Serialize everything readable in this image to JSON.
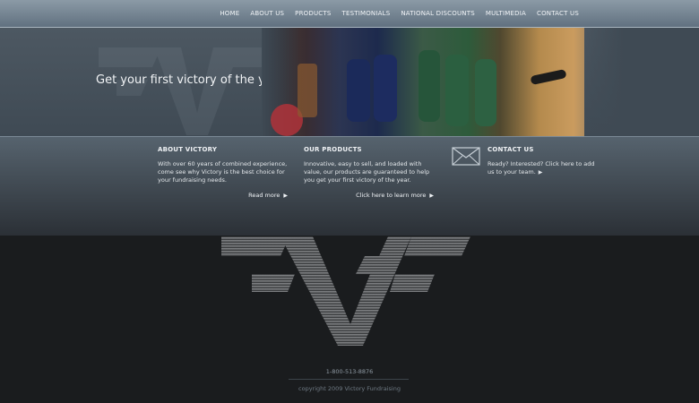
{
  "nav": {
    "items": [
      "HOME",
      "ABOUT US",
      "PRODUCTS",
      "TESTIMONIALS",
      "NATIONAL DISCOUNTS",
      "MULTIMEDIA",
      "CONTACT US"
    ]
  },
  "hero": {
    "headline": "Get your first victory of the year..."
  },
  "about": {
    "title": "ABOUT VICTORY",
    "body": "With over 60 years of combined experience, come see why Victory is the best choice for your fundraising needs.",
    "link": "Read more"
  },
  "products": {
    "title": "OUR PRODUCTS",
    "body": "Innovative, easy to sell, and loaded with value, our products are guaranteed to help you get your first victory of the year.",
    "link": "Click here to learn more"
  },
  "contact": {
    "title": "CONTACT US",
    "body": "Ready? Interested? Click here to add us to your team.",
    "icon": "envelope-icon"
  },
  "footer": {
    "phone": "1-800-513-8876",
    "copyright": "copyright 2009 Victory Fundraising"
  },
  "colors": {
    "topbar": "#617180",
    "hero": "#3f4a54",
    "background": "#1a1c1e"
  }
}
